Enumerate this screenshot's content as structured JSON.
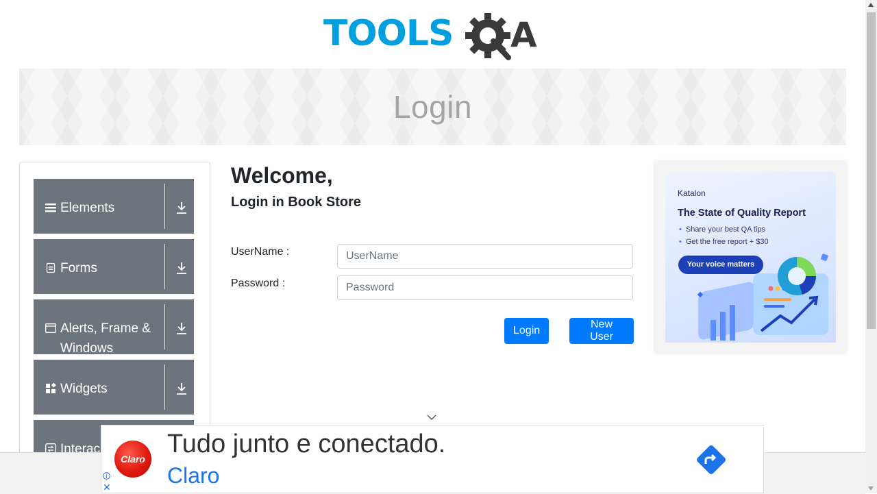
{
  "header": {
    "logo_text": "TOOLSQA",
    "logo_colors": {
      "tools": "#00a0e0",
      "qa": "#3a3a3a"
    }
  },
  "banner": {
    "title": "Login"
  },
  "sidebar": {
    "groups": [
      {
        "label": "Elements",
        "icon": "hamburger-icon"
      },
      {
        "label": "Forms",
        "icon": "document-icon"
      },
      {
        "label": "Alerts, Frame & Windows",
        "icon": "window-icon"
      },
      {
        "label": "Widgets",
        "icon": "widgets-icon"
      },
      {
        "label": "Interac",
        "icon": "interactions-icon"
      }
    ]
  },
  "main": {
    "welcome": "Welcome,",
    "subtitle": "Login in Book Store",
    "username_label": "UserName :",
    "username_placeholder": "UserName",
    "password_label": "Password :",
    "password_placeholder": "Password",
    "login_button": "Login",
    "new_user_button": "New User"
  },
  "side_ad": {
    "brand": "Katalon",
    "title": "The State of Quality Report",
    "bullets": [
      "Share your best QA tips",
      "Get the free report + $30"
    ],
    "cta": "Your voice matters"
  },
  "bottom_ad": {
    "logo_text": "Claro",
    "headline": "Tudo junto e conectado.",
    "advertiser": "Claro",
    "close": "✕"
  },
  "colors": {
    "sidebar_group_bg": "#6c757d",
    "primary_button": "#007bff",
    "banner_text": "#a4a4a4"
  }
}
